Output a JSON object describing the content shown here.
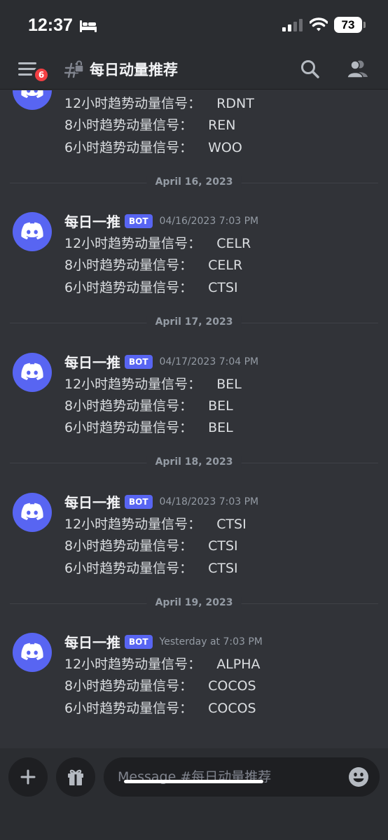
{
  "status_bar": {
    "time": "12:37",
    "battery": "73"
  },
  "header": {
    "badge_count": "6",
    "channel_name": "每日动量推荐"
  },
  "messages": {
    "partial": {
      "lines": [
        {
          "label": "12小时趋势动量信号：",
          "value": "RDNT"
        },
        {
          "label": "8小时趋势动量信号：",
          "value": "REN"
        },
        {
          "label": "6小时趋势动量信号：",
          "value": "WOO"
        }
      ]
    },
    "dividers": [
      "April 16, 2023",
      "April 17, 2023",
      "April 18, 2023",
      "April 19, 2023"
    ],
    "groups": [
      {
        "author": "每日一推",
        "tag": "BOT",
        "timestamp": "04/16/2023 7:03 PM",
        "lines": [
          {
            "label": "12小时趋势动量信号：",
            "value": "CELR"
          },
          {
            "label": "8小时趋势动量信号：",
            "value": "CELR"
          },
          {
            "label": "6小时趋势动量信号：",
            "value": "CTSI"
          }
        ]
      },
      {
        "author": "每日一推",
        "tag": "BOT",
        "timestamp": "04/17/2023 7:04 PM",
        "lines": [
          {
            "label": "12小时趋势动量信号：",
            "value": "BEL"
          },
          {
            "label": "8小时趋势动量信号：",
            "value": "BEL"
          },
          {
            "label": "6小时趋势动量信号：",
            "value": "BEL"
          }
        ]
      },
      {
        "author": "每日一推",
        "tag": "BOT",
        "timestamp": "04/18/2023 7:03 PM",
        "lines": [
          {
            "label": "12小时趋势动量信号：",
            "value": "CTSI"
          },
          {
            "label": "8小时趋势动量信号：",
            "value": "CTSI"
          },
          {
            "label": "6小时趋势动量信号：",
            "value": "CTSI"
          }
        ]
      },
      {
        "author": "每日一推",
        "tag": "BOT",
        "timestamp": "Yesterday at 7:03 PM",
        "lines": [
          {
            "label": "12小时趋势动量信号：",
            "value": "ALPHA"
          },
          {
            "label": "8小时趋势动量信号：",
            "value": "COCOS"
          },
          {
            "label": "6小时趋势动量信号：",
            "value": "COCOS"
          }
        ]
      }
    ]
  },
  "composer": {
    "placeholder": "Message #每日动量推荐"
  },
  "colors": {
    "background": "#313338",
    "header_background": "#2b2d31",
    "blurple": "#5865f2",
    "badge_red": "#f23f43",
    "muted_text": "#949ba4"
  },
  "icons": [
    "bed-icon",
    "cellular-signal-icon",
    "wifi-icon",
    "battery-icon",
    "hamburger-menu-icon",
    "locked-thread-channel-icon",
    "search-icon",
    "members-icon",
    "discord-logo-icon",
    "plus-icon",
    "gift-icon",
    "emoji-icon"
  ]
}
